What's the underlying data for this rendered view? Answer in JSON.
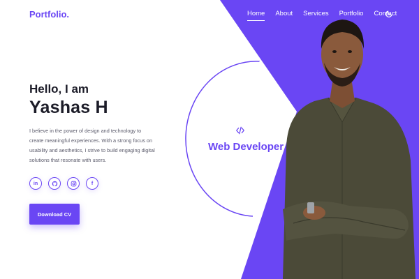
{
  "brand": {
    "logo": "Portfolio."
  },
  "nav": {
    "items": [
      {
        "label": "Home",
        "active": true
      },
      {
        "label": "About",
        "active": false
      },
      {
        "label": "Services",
        "active": false
      },
      {
        "label": "Portfolio",
        "active": false
      },
      {
        "label": "Contact",
        "active": false
      }
    ],
    "theme_toggle_icon": "moon-icon"
  },
  "hero": {
    "greeting": "Hello, I am",
    "name": "Yashas H",
    "description": "I believe in the power of design and technology to create meaningful experiences. With a strong focus on usability and aesthetics, I strive to build engaging digital solutions that resonate with users.",
    "role": "Web Developer",
    "role_icon": "code-icon",
    "cta_label": "Download CV"
  },
  "socials": [
    {
      "name": "linkedin",
      "icon": "linkedin-icon",
      "glyph": "in"
    },
    {
      "name": "github",
      "icon": "github-icon"
    },
    {
      "name": "instagram",
      "icon": "instagram-icon"
    },
    {
      "name": "facebook",
      "icon": "facebook-icon",
      "glyph": "f"
    }
  ],
  "colors": {
    "accent": "#6a46f4",
    "text": "#1c1c28",
    "muted": "#5b5b6b",
    "background": "#ffffff"
  }
}
